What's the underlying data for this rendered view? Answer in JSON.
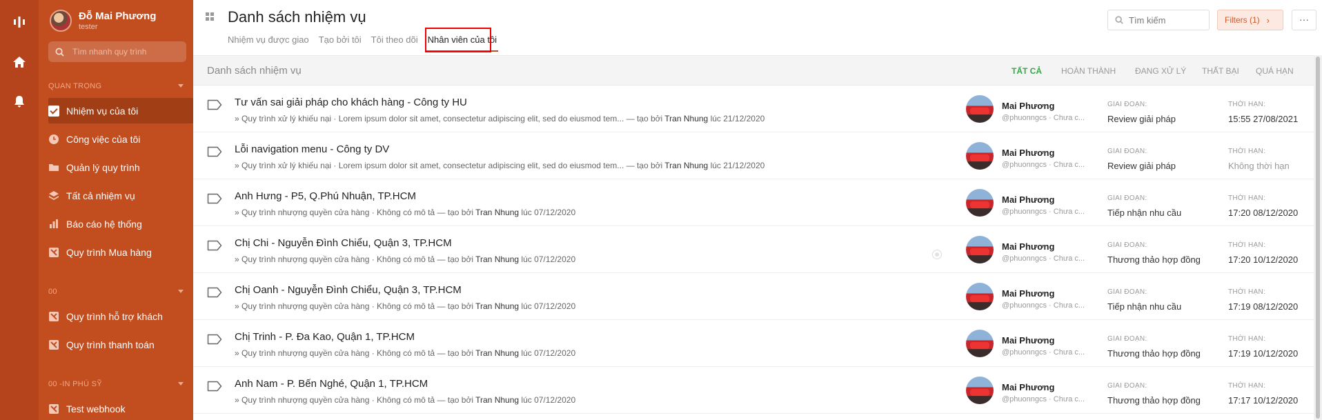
{
  "user": {
    "name": "Đỗ Mai Phương",
    "role": "tester"
  },
  "sidebar": {
    "search_placeholder": "Tìm nhanh quy trình",
    "sections": [
      {
        "label": "QUAN TRỌNG"
      },
      {
        "label": "00"
      },
      {
        "label": "00 -IN PHÚ SỸ"
      }
    ],
    "items": [
      {
        "label": "Nhiệm vụ của tôi",
        "icon": "check-square-icon",
        "active": true
      },
      {
        "label": "Công việc của tôi",
        "icon": "clock-icon"
      },
      {
        "label": "Quản lý quy trình",
        "icon": "folder-icon"
      },
      {
        "label": "Tất cả nhiệm vụ",
        "icon": "layers-icon"
      },
      {
        "label": "Báo cáo hệ thống",
        "icon": "bar-chart-icon"
      },
      {
        "label": "Quy trình Mua hàng",
        "icon": "process-icon"
      },
      {
        "label": "Quy trình hỗ trợ khách",
        "icon": "process-icon"
      },
      {
        "label": "Quy trình thanh toán",
        "icon": "process-icon"
      },
      {
        "label": "Test webhook",
        "icon": "process-icon"
      }
    ]
  },
  "header": {
    "title": "Danh sách nhiệm vụ",
    "tabs": [
      {
        "label": "Nhiệm vụ được giao"
      },
      {
        "label": "Tạo bởi tôi"
      },
      {
        "label": "Tôi theo dõi"
      },
      {
        "label": "Nhân viên của tôi",
        "active": true
      }
    ],
    "search_placeholder": "Tìm kiếm",
    "filters_label": "Filters (1)",
    "more_label": "···"
  },
  "toolbar": {
    "title": "Danh sách nhiệm vụ",
    "filters": [
      {
        "label": "TẤT CẢ",
        "active": true
      },
      {
        "label": "HOÀN THÀNH"
      },
      {
        "label": "ĐANG XỬ LÝ"
      },
      {
        "label": "THẤT BẠI"
      },
      {
        "label": "QUÁ HẠN"
      }
    ]
  },
  "labels": {
    "stage": "GIAI ĐOẠN:",
    "due": "THỜI HẠN:"
  },
  "tasks": [
    {
      "title": "Tư vấn sai giải pháp cho khách hàng - Công ty HU",
      "subtitle": "» Quy trình xử lý khiếu nại · Lorem ipsum dolor sit amet, consectetur adipiscing elit, sed do eiusmod tem... — tạo bởi ",
      "creator": "Tran Nhung",
      "created": " lúc 21/12/2020",
      "assignee": "Mai Phương",
      "assignee_sub": "@phuonngcs · Chưa c...",
      "stage": "Review giải pháp",
      "due": "15:55 27/08/2021"
    },
    {
      "title": "Lỗi navigation menu - Công ty DV",
      "subtitle": "» Quy trình xử lý khiếu nại · Lorem ipsum dolor sit amet, consectetur adipiscing elit, sed do eiusmod tem... — tạo bởi ",
      "creator": "Tran Nhung",
      "created": " lúc 21/12/2020",
      "assignee": "Mai Phương",
      "assignee_sub": "@phuonngcs · Chưa c...",
      "stage": "Review giải pháp",
      "due": "Không thời hạn",
      "due_muted": true
    },
    {
      "title": "Anh Hưng - P5, Q.Phú Nhuận, TP.HCM",
      "subtitle": "» Quy trình nhượng quyền cửa hàng · Không có mô tả — tạo bởi ",
      "creator": "Tran Nhung",
      "created": " lúc 07/12/2020",
      "assignee": "Mai Phương",
      "assignee_sub": "@phuonngcs · Chưa c...",
      "stage": "Tiếp nhận nhu cầu",
      "due": "17:20 08/12/2020"
    },
    {
      "title": "Chị Chi - Nguyễn Đình Chiểu, Quận 3, TP.HCM",
      "subtitle": "» Quy trình nhượng quyền cửa hàng · Không có mô tả — tạo bởi ",
      "creator": "Tran Nhung",
      "created": " lúc 07/12/2020",
      "assignee": "Mai Phương",
      "assignee_sub": "@phuonngcs · Chưa c...",
      "stage": "Thương thảo hợp đồng",
      "due": "17:20 10/12/2020",
      "radio": true
    },
    {
      "title": "Chị Oanh - Nguyễn Đình Chiểu, Quận 3, TP.HCM",
      "subtitle": "» Quy trình nhượng quyền cửa hàng · Không có mô tả — tạo bởi ",
      "creator": "Tran Nhung",
      "created": " lúc 07/12/2020",
      "assignee": "Mai Phương",
      "assignee_sub": "@phuonngcs · Chưa c...",
      "stage": "Tiếp nhận nhu cầu",
      "due": "17:19 08/12/2020"
    },
    {
      "title": "Chị Trinh - P. Đa Kao, Quận 1, TP.HCM",
      "subtitle": "» Quy trình nhượng quyền cửa hàng · Không có mô tả — tạo bởi ",
      "creator": "Tran Nhung",
      "created": " lúc 07/12/2020",
      "assignee": "Mai Phương",
      "assignee_sub": "@phuonngcs · Chưa c...",
      "stage": "Thương thảo hợp đồng",
      "due": "17:19 10/12/2020"
    },
    {
      "title": "Anh Nam - P. Bến Nghé, Quận 1, TP.HCM",
      "subtitle": "» Quy trình nhượng quyền cửa hàng · Không có mô tả — tạo bởi ",
      "creator": "Tran Nhung",
      "created": " lúc 07/12/2020",
      "assignee": "Mai Phương",
      "assignee_sub": "@phuonngcs · Chưa c...",
      "stage": "Thương thảo hợp đồng",
      "due": "17:17 10/12/2020"
    }
  ]
}
